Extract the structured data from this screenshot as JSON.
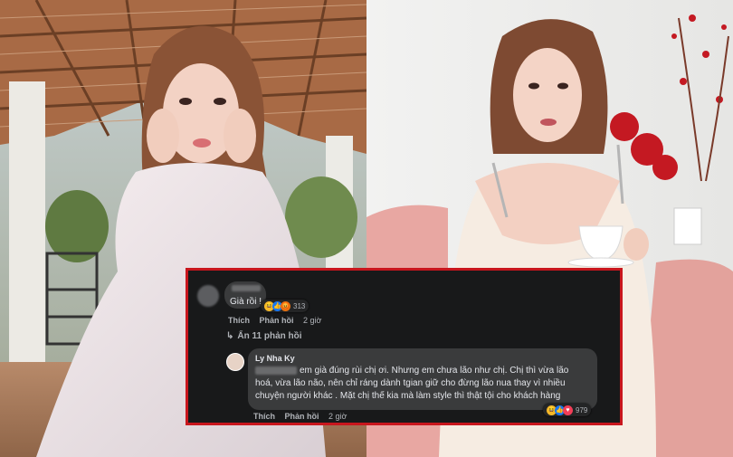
{
  "comment": {
    "text": "Già rồi !",
    "reaction_count": "313",
    "like_label": "Thích",
    "reply_label": "Phản hồi",
    "time": "2 giờ"
  },
  "hidden_replies": "Ẩn 11 phản hồi",
  "reply": {
    "author": "Ly Nha Ky",
    "lines": [
      "em già đúng rùi chị ơi. Nhưng em chưa lão như chị. Chị thì vừa lão",
      "hoá, vừa lão não, nên chỉ ráng dành tgian giữ cho đừng lão nua thay vì nhiều",
      "chuyện người khác . Mặt chị thế kia mà làm style thì thật tội cho khách hàng"
    ],
    "reaction_count": "979",
    "like_label": "Thích",
    "reply_label": "Phản hồi",
    "time": "2 giờ"
  },
  "colors": {
    "border": "#c8161d",
    "panel": "#18191a",
    "bubble": "#3a3b3c"
  }
}
